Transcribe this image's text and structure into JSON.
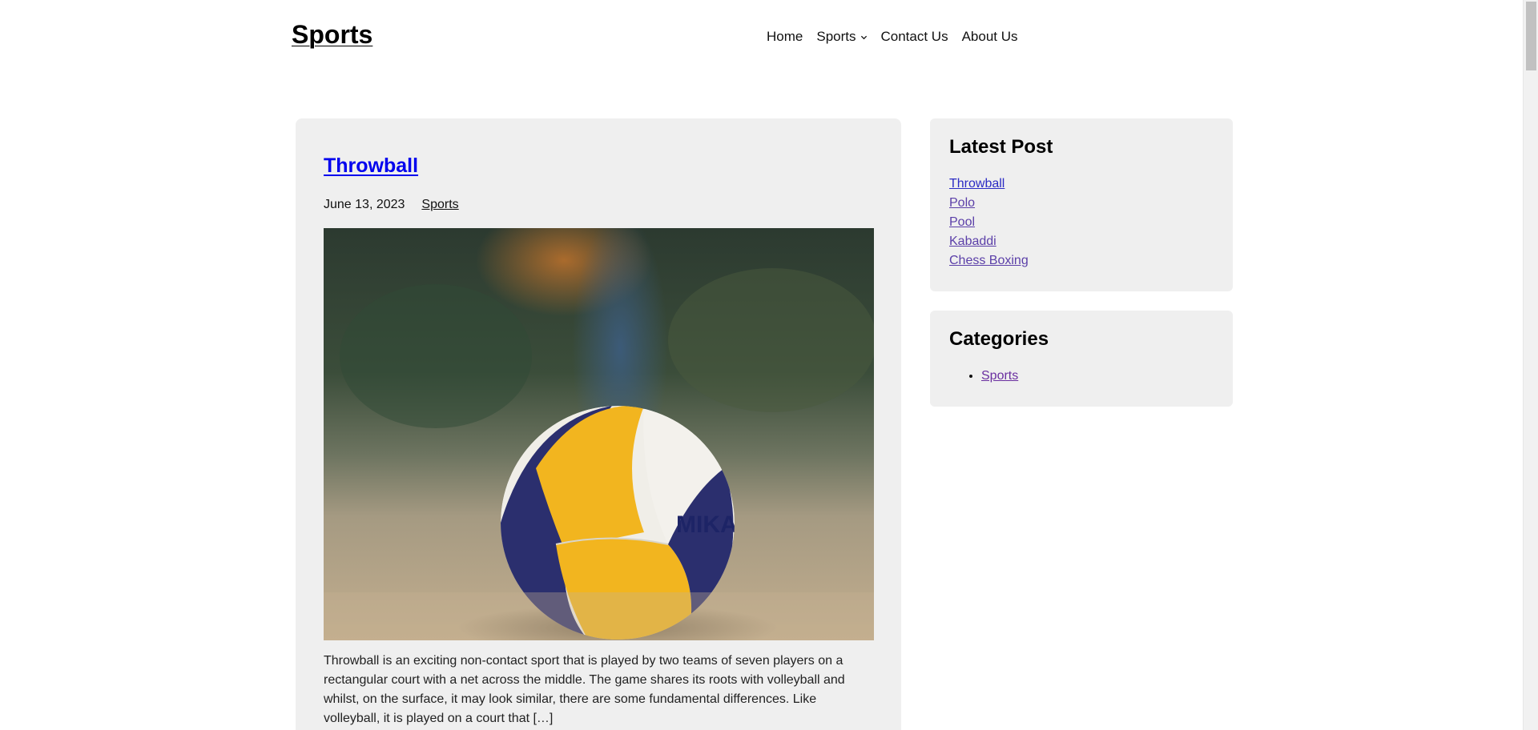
{
  "header": {
    "site_title": "Sports",
    "nav": [
      {
        "label": "Home"
      },
      {
        "label": "Sports",
        "has_dropdown": true
      },
      {
        "label": "Contact Us"
      },
      {
        "label": "About Us"
      }
    ]
  },
  "post": {
    "title": "Throwball",
    "date": "June 13, 2023",
    "category": "Sports",
    "image_alt": "volleyball on sand",
    "excerpt": "Throwball is an exciting non-contact sport that is played by two teams of seven players on a rectangular court with a net across the middle. The game shares its roots with volleyball and whilst, on the surface, it may look similar, there are some fundamental differences. Like volleyball, it is played on a court that […]"
  },
  "sidebar": {
    "latest": {
      "title": "Latest Post",
      "items": [
        "Throwball",
        "Polo",
        "Pool",
        "Kabaddi",
        "Chess Boxing"
      ]
    },
    "categories": {
      "title": "Categories",
      "items": [
        "Sports"
      ]
    }
  },
  "colors": {
    "link": "#0000ee",
    "visited_link": "#5b3fa8",
    "card_bg": "#efefef"
  }
}
